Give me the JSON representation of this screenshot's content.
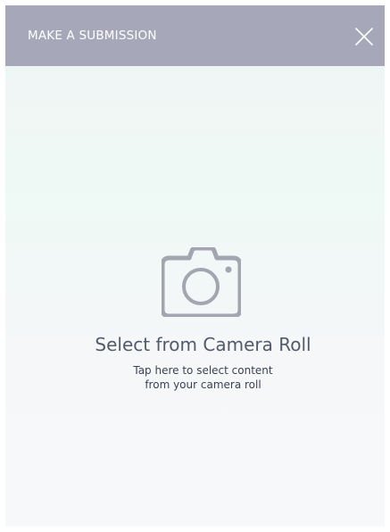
{
  "header": {
    "title": "MAKE A SUBMISSION",
    "close_icon": "close-x-icon",
    "background": "#a6a8b9"
  },
  "camera_roll": {
    "icon": "camera-icon",
    "title": "Select from Camera Roll",
    "description_line1": "Tap here to select content",
    "description_line2": "from your camera roll"
  },
  "colors": {
    "icon_gray": "#a3a5b1",
    "title_text": "#525a6c",
    "body_text": "#3c4253"
  }
}
